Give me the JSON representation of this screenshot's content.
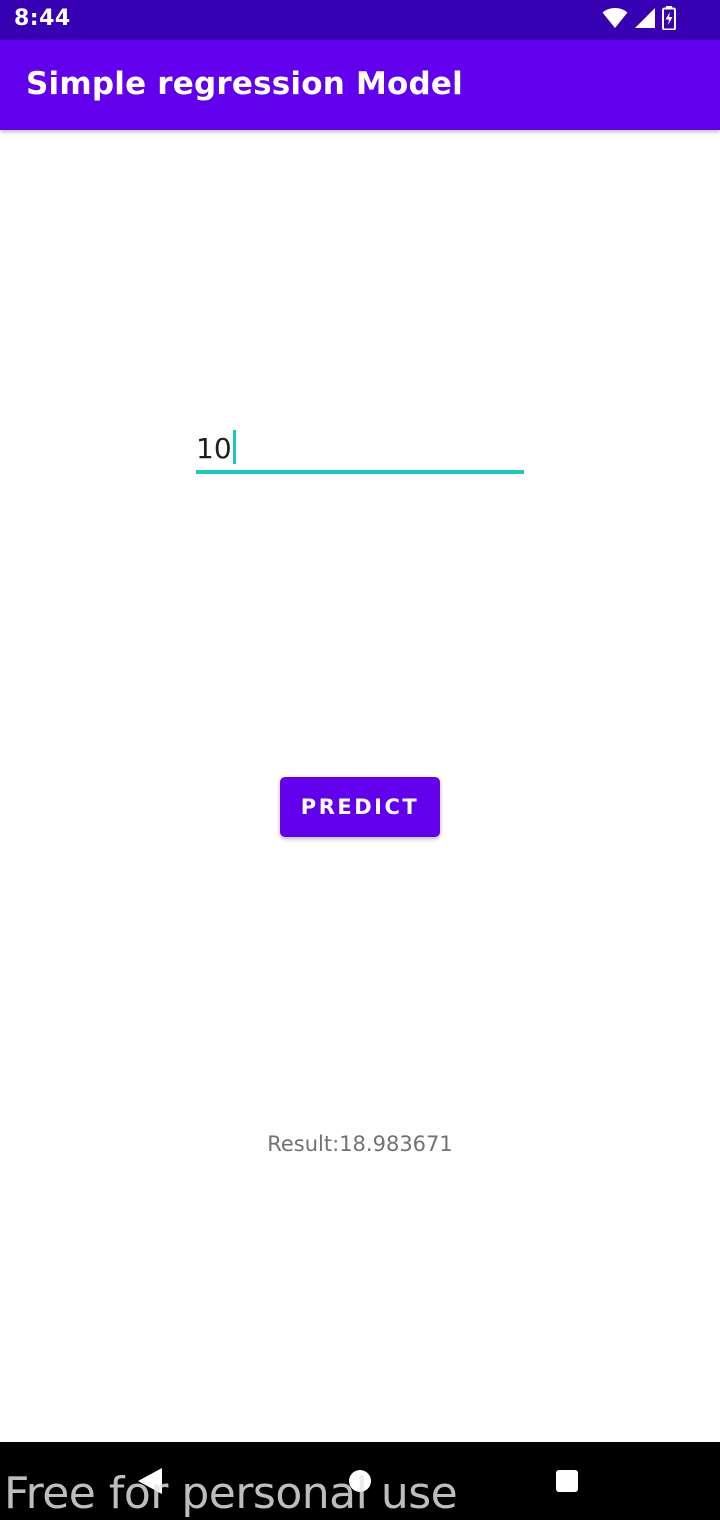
{
  "status_bar": {
    "time": "8:44",
    "icons": [
      "wifi-icon",
      "cellular-signal-icon",
      "battery-charging-icon"
    ]
  },
  "app_bar": {
    "title": "Simple regression Model"
  },
  "input": {
    "value": "10"
  },
  "predict_button": {
    "label": "PREDICT"
  },
  "result": {
    "text": "Result:18.983671"
  },
  "navigation_bar": {
    "icons": [
      "back-icon",
      "home-icon",
      "recents-icon"
    ]
  },
  "watermark": {
    "text": "Free for personal use"
  },
  "colors": {
    "status_bar": "#3700b3",
    "app_bar": "#6200ee",
    "button": "#6200ee",
    "input_accent": "#18c9c0",
    "result_text": "#727272"
  }
}
